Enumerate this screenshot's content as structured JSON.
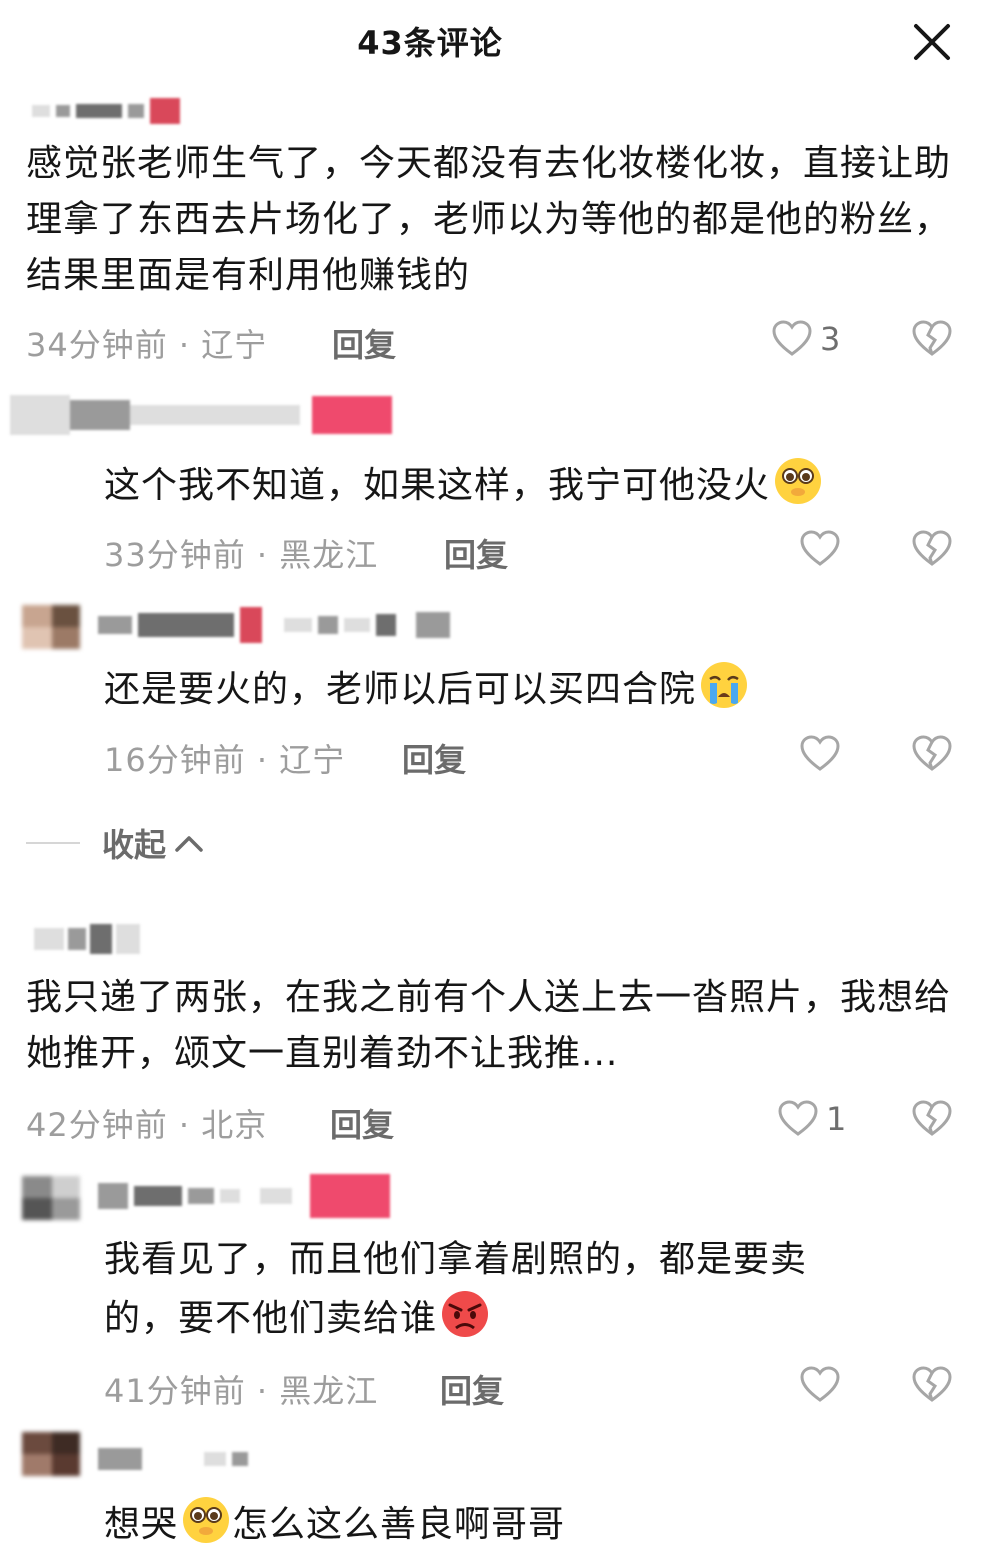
{
  "header": {
    "title": "43条评论",
    "close_icon": "close-icon"
  },
  "comments": [
    {
      "text": "感觉张老师生气了，今天都没有去化妆楼化妆，直接让助理拿了东西去片场化了，老师以为等他的都是他的粉丝，结果里面是有利用他赚钱的",
      "meta": "34分钟前 · 辽宁",
      "reply": "回复",
      "likes": "3"
    },
    {
      "text": "这个我不知道，如果这样，我宁可他没火",
      "emoji": "pleading-face-emoji",
      "meta": "33分钟前 · 黑龙江",
      "reply": "回复"
    },
    {
      "text": "还是要火的，老师以后可以买四合院",
      "emoji": "crying-face-emoji",
      "meta": "16分钟前 · 辽宁",
      "reply": "回复"
    },
    {
      "text": "我只递了两张，在我之前有个人送上去一沓照片，我想给她推开，颂文一直别着劲不让我推...",
      "meta": "42分钟前 · 北京",
      "reply": "回复",
      "likes": "1"
    },
    {
      "text_line1": "我看见了，而且他们拿着剧照的，都是要卖",
      "text_line2": "的，要不他们卖给谁",
      "emoji": "angry-face-emoji",
      "meta": "41分钟前 · 黑龙江",
      "reply": "回复"
    },
    {
      "text_prefix": "想哭",
      "text": "怎么这么善良啊哥哥",
      "emoji": "pleading-face-emoji"
    }
  ],
  "collapse": {
    "label": "收起"
  },
  "colors": {
    "text": "#161616",
    "meta": "#9d9d9d",
    "reply": "#6b6b6b",
    "icon": "#a6a6a6"
  }
}
